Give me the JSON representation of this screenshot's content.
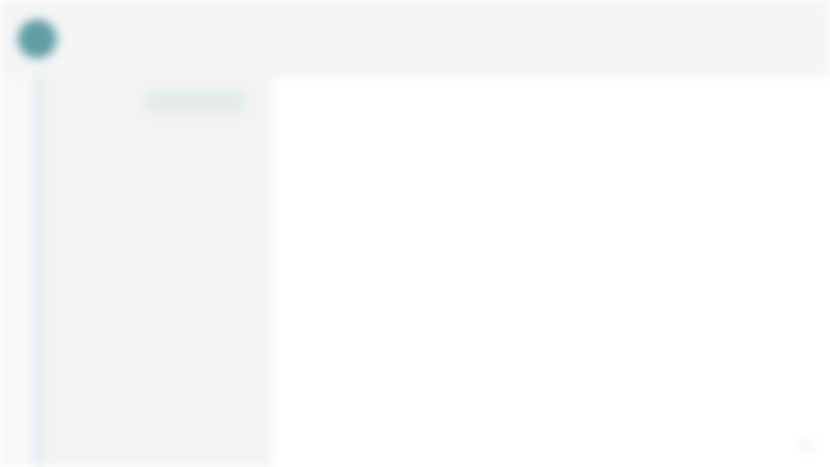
{
  "header": {
    "title": "",
    "action_label": "",
    "menu_icon": "more-icon"
  },
  "sidebar": {
    "heading": "",
    "filter_label": "",
    "items": [
      {
        "label": ""
      },
      {
        "label": ""
      },
      {
        "label": ""
      },
      {
        "label": ""
      },
      {
        "label": ""
      },
      {
        "label": ""
      },
      {
        "label": ""
      },
      {
        "label": ""
      }
    ]
  },
  "main": {
    "content": ""
  },
  "colors": {
    "accent": "#5f9ea4",
    "sidebar_background": "#f2f4f4",
    "main_background": "#ffffff",
    "topbar_background": "#f4f5f5"
  },
  "icons": {
    "logo": "app-logo-icon",
    "menu": "more-icon"
  }
}
